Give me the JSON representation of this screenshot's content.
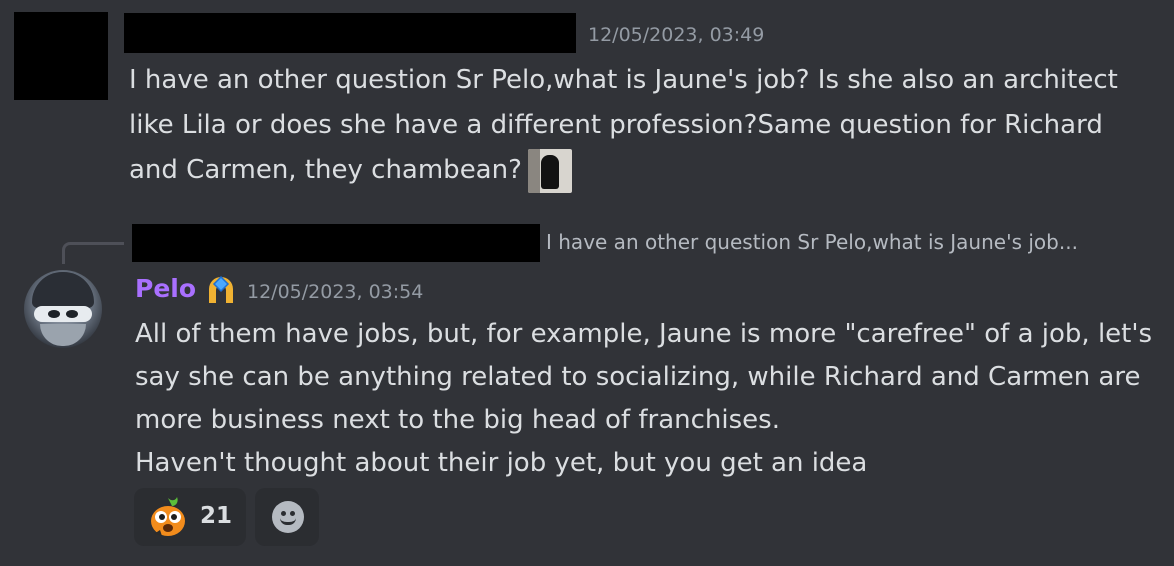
{
  "message1": {
    "timestamp": "12/05/2023, 03:49",
    "line1": "I have an other question Sr Pelo,what is Jaune's job? Is she also an architect",
    "line2": "like Lila or does she have a different profession?Same question for Richard",
    "line3": "and Carmen, they chambean?"
  },
  "message2": {
    "reply_preview": "I have an other question Sr Pelo,what is Jaune's job...",
    "author": "Pelo",
    "author_color": "#a970ff",
    "timestamp": "12/05/2023, 03:54",
    "line1": "All of them have jobs, but, for example, Jaune is more \"carefree\" of a job, let's",
    "line2": "say she can be anything related to socializing, while Richard and Carmen are",
    "line3": "more business next to the big head of franchises.",
    "line4": "Haven't thought about their job yet, but you get an idea"
  },
  "reactions": {
    "first": {
      "emoji": "orange-creature-emoji",
      "count": "21"
    },
    "add": {
      "icon": "smiley-add-reaction-icon"
    }
  }
}
